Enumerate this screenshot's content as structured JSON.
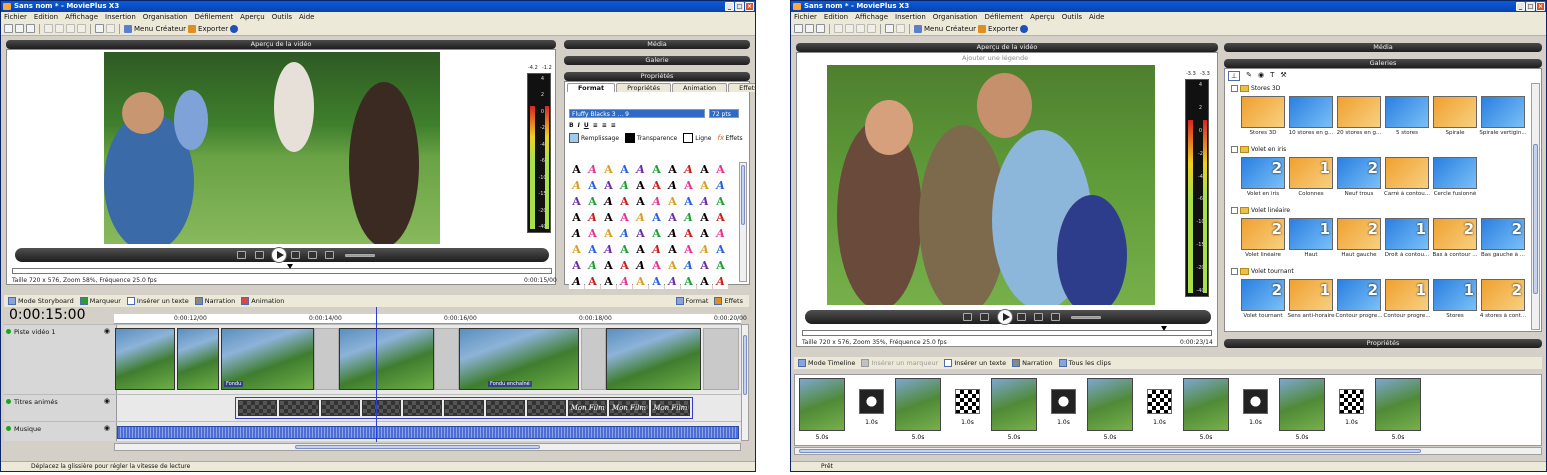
{
  "left_window": {
    "title": "Sans nom * - MoviePlus X3",
    "menu": [
      "Fichier",
      "Edition",
      "Affichage",
      "Insertion",
      "Organisation",
      "Défilement",
      "Aperçu",
      "Outils",
      "Aide"
    ],
    "toolbar": {
      "menu_createur": "Menu Créateur",
      "exporter": "Exporter"
    },
    "preview": {
      "header": "Aperçu de la vidéo",
      "meter_labels": [
        "-4.2",
        "-1.2"
      ],
      "meter_scale": [
        "4",
        "2",
        "0",
        "-2",
        "-4",
        "-6",
        "-10",
        "-15",
        "-20",
        "-40"
      ],
      "info": "Taille 720 x 576, Zoom 58%, Fréquence 25.0 fps",
      "time": "0:00:15/00"
    },
    "right_panels": {
      "media": "Média",
      "galerie": "Galerie",
      "proprietes": "Propriétés"
    },
    "tabs": [
      "Format",
      "Propriétés",
      "Animation",
      "Effets"
    ],
    "font_value": "Fluffy Blacks 3 ... 9",
    "font_size": "72 pts",
    "fill_labels": {
      "remplissage": "Remplissage",
      "transparence": "Transparence",
      "ligne": "Ligne",
      "effets": "Effets"
    },
    "font_samples": [
      "A",
      "A",
      "A",
      "A",
      "A",
      "A",
      "A",
      "A",
      "A",
      "A",
      "A",
      "A",
      "A",
      "A",
      "A",
      "A",
      "A",
      "A",
      "A",
      "A",
      "A",
      "A",
      "A",
      "A",
      "A",
      "A",
      "A",
      "A",
      "A",
      "A",
      "A",
      "A",
      "A",
      "A",
      "A",
      "A",
      "A",
      "A",
      "A",
      "A",
      "A",
      "A",
      "A",
      "A",
      "A",
      "A",
      "A",
      "A",
      "A",
      "A",
      "A",
      "A",
      "A",
      "A",
      "A",
      "A",
      "A",
      "A",
      "A",
      "A",
      "A",
      "A",
      "A",
      "A",
      "A",
      "A",
      "A",
      "A",
      "A",
      "A",
      "A",
      "A",
      "A",
      "A",
      "A",
      "A",
      "A",
      "A",
      "A",
      "A"
    ],
    "timeline_bar": {
      "mode": "Mode Storyboard",
      "marqueur": "Marqueur",
      "inserer_texte": "Insérer un texte",
      "narration": "Narration",
      "animation": "Animation",
      "format": "Format",
      "effets": "Effets"
    },
    "timecode": "0:00:15:00",
    "ruler": [
      "0:00:12/00",
      "0:00:14/00",
      "0:00:16/00",
      "0:00:18/00",
      "0:00:20/00"
    ],
    "tracks": {
      "video": "Piste vidéo 1",
      "titres": "Titres animés",
      "musique": "Musique"
    },
    "clip_captions": [
      "Fondu",
      "Fondu enchaîné"
    ],
    "text_clips": [
      "",
      "",
      "",
      "",
      "",
      "",
      "",
      "",
      "Mon Film",
      "Mon Film",
      "Mon Film"
    ],
    "status": "Déplacez la glissière pour régler la vitesse de lecture"
  },
  "right_window": {
    "title": "Sans nom * - MoviePlus X3",
    "menu": [
      "Fichier",
      "Edition",
      "Affichage",
      "Insertion",
      "Organisation",
      "Défilement",
      "Aperçu",
      "Outils",
      "Aide"
    ],
    "toolbar": {
      "menu_createur": "Menu Créateur",
      "exporter": "Exporter"
    },
    "preview": {
      "header": "Aperçu de la vidéo",
      "add_caption": "Ajouter une légende",
      "meter_labels": [
        "-3.3",
        "-3.3"
      ],
      "meter_scale": [
        "4",
        "2",
        "0",
        "-2",
        "-4",
        "-6",
        "-10",
        "-15",
        "-20",
        "-40"
      ],
      "info": "Taille 720 x 576, Zoom 35%, Fréquence 25.0 fps",
      "time": "0:00:23/14"
    },
    "right_panels": {
      "media": "Média",
      "galeries": "Galeries",
      "proprietes": "Propriétés"
    },
    "gallery": [
      {
        "section": "Stores 3D",
        "items": [
          {
            "label": "Stores 3D",
            "num": ""
          },
          {
            "label": "10 stores en g...",
            "num": ""
          },
          {
            "label": "20 stores en g...",
            "num": ""
          },
          {
            "label": "5 stores",
            "num": ""
          },
          {
            "label": "Spirale",
            "num": ""
          },
          {
            "label": "Spirale vertigin...",
            "num": ""
          }
        ]
      },
      {
        "section": "Volet en iris",
        "items": [
          {
            "label": "Volet en iris",
            "num": "2"
          },
          {
            "label": "Colonnes",
            "num": "1"
          },
          {
            "label": "Neuf trous",
            "num": "2"
          },
          {
            "label": "Carré à contou...",
            "num": ""
          },
          {
            "label": "Cercle fusionné",
            "num": ""
          }
        ]
      },
      {
        "section": "Volet linéaire",
        "items": [
          {
            "label": "Volet linéaire",
            "num": "2"
          },
          {
            "label": "Haut",
            "num": "1"
          },
          {
            "label": "Haut gauche",
            "num": "2"
          },
          {
            "label": "Droit à contou...",
            "num": "1"
          },
          {
            "label": "Bas à contour ...",
            "num": "2"
          },
          {
            "label": "Bas gauche à ...",
            "num": "2"
          }
        ]
      },
      {
        "section": "Volet tournant",
        "items": [
          {
            "label": "Volet tournant",
            "num": "2"
          },
          {
            "label": "Sens anti-horaire",
            "num": "1"
          },
          {
            "label": "Contour progre...",
            "num": "2"
          },
          {
            "label": "Contour progre...",
            "num": "1"
          },
          {
            "label": "Stores",
            "num": "1"
          },
          {
            "label": "4 stores à cont...",
            "num": "2"
          }
        ]
      }
    ],
    "storyboard_bar": {
      "mode": "Mode Timeline",
      "inserer_marqueur": "Insérer un marqueur",
      "inserer_texte": "Insérer un texte",
      "narration": "Narration",
      "tous_clips": "Tous les clips"
    },
    "storyboard": [
      {
        "type": "clip",
        "label": "5.0s"
      },
      {
        "type": "trans",
        "label": "1.0s"
      },
      {
        "type": "clip",
        "label": "5.0s"
      },
      {
        "type": "trans",
        "label": "1.0s"
      },
      {
        "type": "clip",
        "label": "5.0s"
      },
      {
        "type": "trans",
        "label": "1.0s"
      },
      {
        "type": "clip",
        "label": "5.0s"
      },
      {
        "type": "trans",
        "label": "1.0s"
      },
      {
        "type": "clip",
        "label": "5.0s"
      },
      {
        "type": "trans",
        "label": "1.0s"
      },
      {
        "type": "clip",
        "label": "5.0s"
      },
      {
        "type": "trans",
        "label": "1.0s"
      },
      {
        "type": "clip",
        "label": "5.0s"
      }
    ],
    "status": "Prêt"
  }
}
